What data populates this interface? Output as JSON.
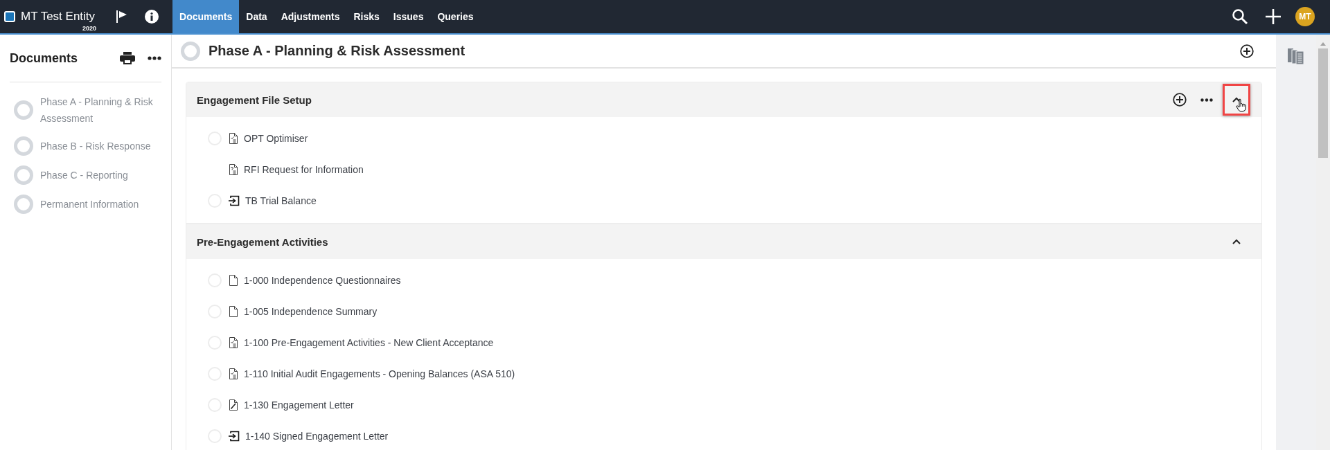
{
  "entity": {
    "name": "MT Test Entity",
    "year": "2020"
  },
  "nav": [
    {
      "label": "Documents",
      "selected": true
    },
    {
      "label": "Data",
      "selected": false
    },
    {
      "label": "Adjustments",
      "selected": false
    },
    {
      "label": "Risks",
      "selected": false
    },
    {
      "label": "Issues",
      "selected": false
    },
    {
      "label": "Queries",
      "selected": false
    }
  ],
  "user": {
    "initials": "MT"
  },
  "sidebar": {
    "title": "Documents",
    "items": [
      {
        "label": "Phase A - Planning & Risk Assessment"
      },
      {
        "label": "Phase B - Risk Response"
      },
      {
        "label": "Phase C - Reporting"
      },
      {
        "label": "Permanent Information"
      }
    ]
  },
  "page": {
    "title": "Phase A - Planning & Risk Assessment"
  },
  "sections": [
    {
      "title": "Engagement File Setup",
      "expanded": true,
      "highlighted": true,
      "toolbar": true,
      "items": [
        {
          "label": "OPT Optimiser",
          "kind": "form",
          "status": true
        },
        {
          "label": "RFI Request for Information",
          "kind": "query",
          "status": false
        },
        {
          "label": "TB Trial Balance",
          "kind": "import",
          "status": true
        }
      ]
    },
    {
      "title": "Pre-Engagement Activities",
      "expanded": true,
      "highlighted": false,
      "toolbar": false,
      "items": [
        {
          "label": "1-000 Independence Questionnaires",
          "kind": "blank",
          "status": true
        },
        {
          "label": "1-005 Independence Summary",
          "kind": "blank",
          "status": true
        },
        {
          "label": "1-100 Pre-Engagement Activities - New Client Acceptance",
          "kind": "form",
          "status": true
        },
        {
          "label": "1-110 Initial Audit Engagements - Opening Balances (ASA 510)",
          "kind": "form",
          "status": true
        },
        {
          "label": "1-130 Engagement Letter",
          "kind": "sign",
          "status": true
        },
        {
          "label": "1-140 Signed Engagement Letter",
          "kind": "import",
          "status": true
        }
      ]
    }
  ]
}
